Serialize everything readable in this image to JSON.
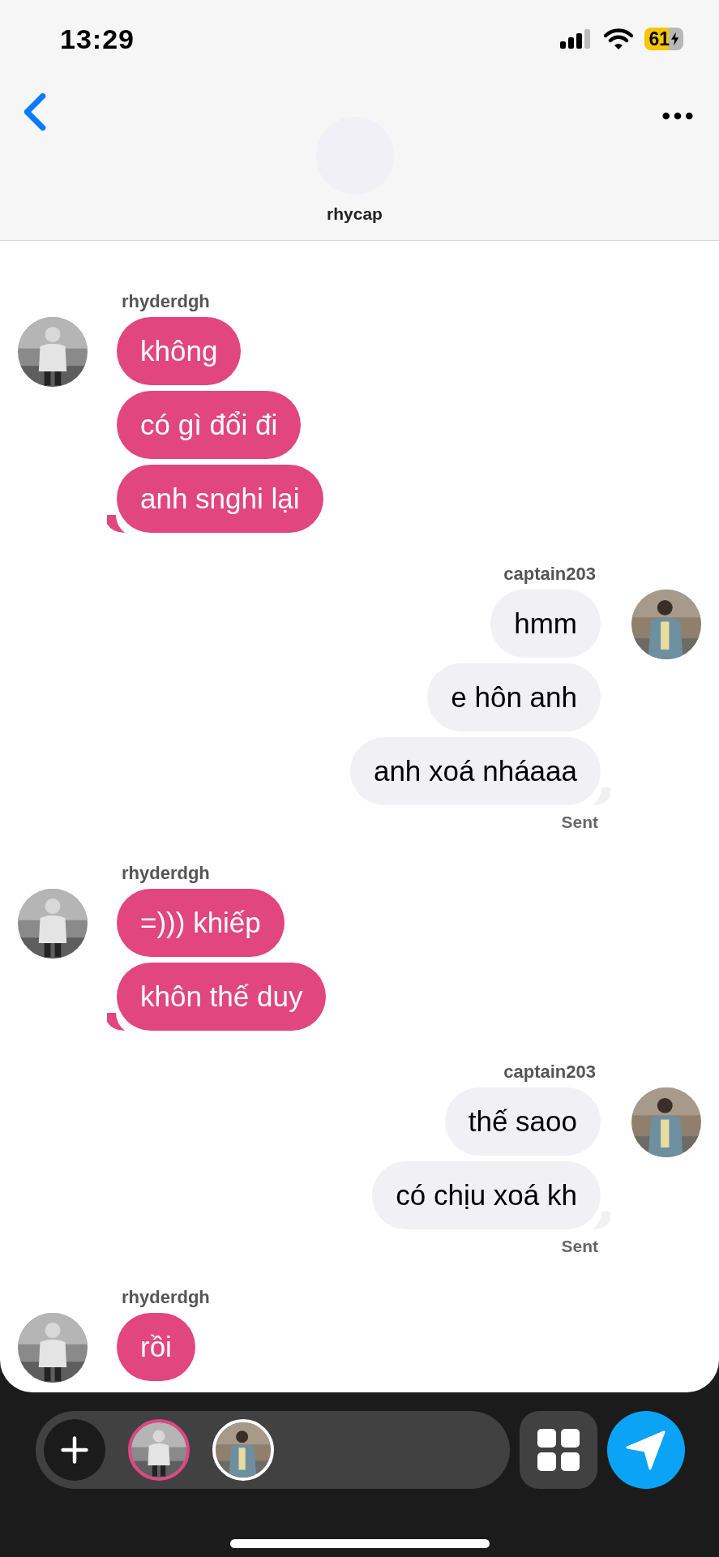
{
  "status_bar": {
    "time": "13:29",
    "battery": "61"
  },
  "header": {
    "title": "rhycap"
  },
  "groups": [
    {
      "kind": "incoming",
      "sender": "rhyderdgh",
      "messages": [
        "không",
        "có gì đổi đi",
        "anh snghi lại"
      ]
    },
    {
      "kind": "outgoing",
      "sender": "captain203",
      "messages": [
        "hmm",
        "e hôn anh",
        "anh xoá nháaaa"
      ],
      "status": "Sent"
    },
    {
      "kind": "incoming",
      "sender": "rhyderdgh",
      "messages": [
        "=))) khiếp",
        "khôn thế duy"
      ]
    },
    {
      "kind": "outgoing",
      "sender": "captain203",
      "messages": [
        "thế saoo",
        "có chịu xoá kh"
      ],
      "status": "Sent"
    },
    {
      "kind": "incoming",
      "sender": "rhyderdgh",
      "messages": [
        "rồi"
      ]
    }
  ],
  "composer": {
    "people": [
      {
        "kind": "incoming",
        "selected": true
      },
      {
        "kind": "outgoing",
        "selected": false
      }
    ]
  }
}
